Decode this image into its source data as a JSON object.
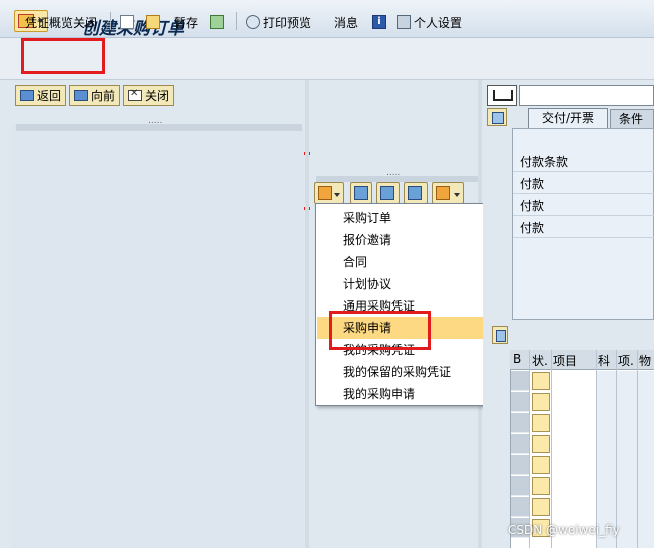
{
  "window": {
    "title": "创建采购订单"
  },
  "toolbar": {
    "doc_overview_off": "凭证概览关闭",
    "hold": "暂存",
    "print_preview": "打印预览",
    "messages": "消息",
    "personal_settings": "个人设置"
  },
  "nav": {
    "back": "返回",
    "forward": "向前",
    "close": "关闭"
  },
  "dropdown": {
    "items": [
      "采购订单",
      "报价邀请",
      "合同",
      "计划协议",
      "通用采购凭证",
      "采购申请",
      "我的采购凭证",
      "我的保留的采购凭证",
      "我的采购申请"
    ],
    "selected": "采购申请"
  },
  "right": {
    "tabs": [
      "交付/开票",
      "条件"
    ],
    "active_tab": "交付/开票",
    "fields": [
      "付款条款",
      "付款",
      "付款",
      "付款"
    ]
  },
  "grid": {
    "headers": [
      "B",
      "状.",
      "项目",
      "科",
      "项.",
      "物"
    ]
  },
  "watermark": "CSDN @weiwei_fiy",
  "colors": {
    "highlight": "#e21c1c",
    "selected_item": "#fcd982"
  }
}
